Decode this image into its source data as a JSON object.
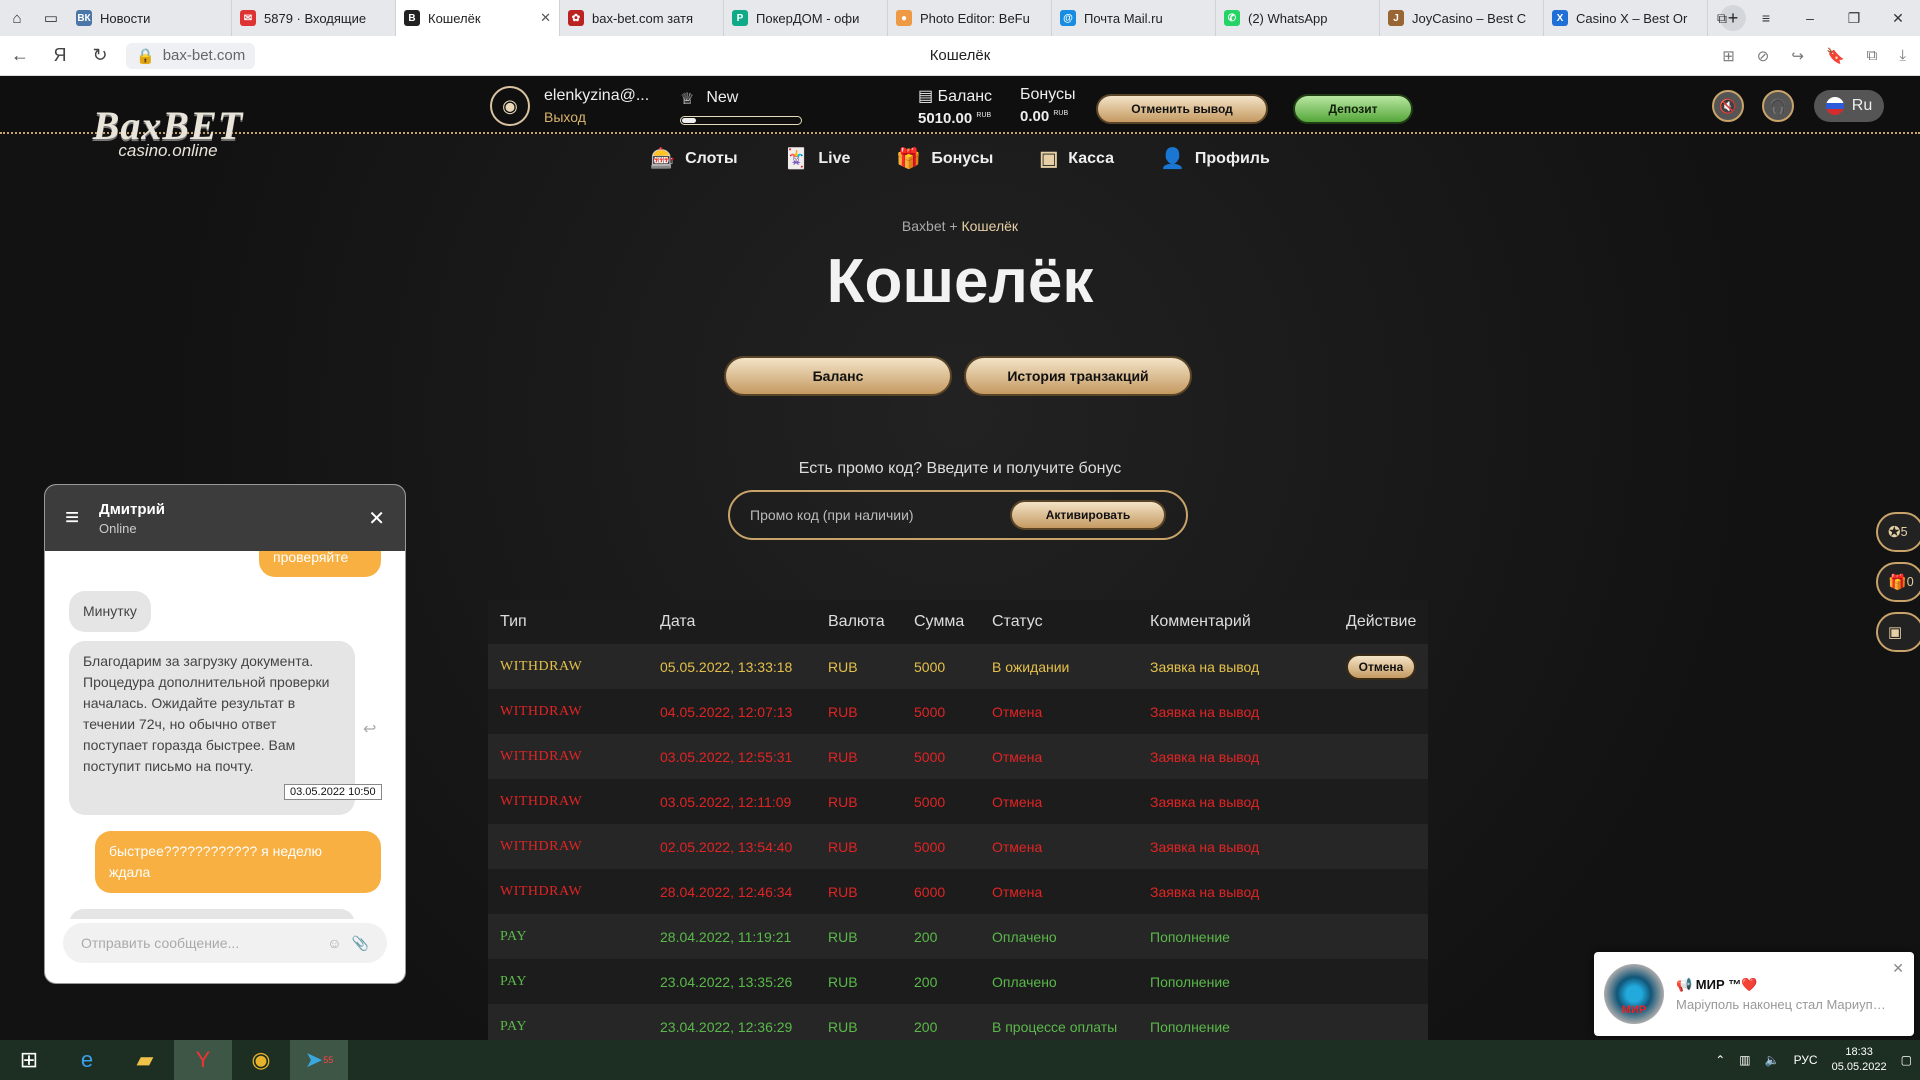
{
  "browser": {
    "tabs": [
      {
        "title": "Новости",
        "color": "#4a76a8",
        "glyph": "ВК",
        "active": false
      },
      {
        "title": "5879 · Входящие",
        "color": "#d33",
        "glyph": "✉",
        "active": false
      },
      {
        "title": "Кошелёк",
        "color": "#222",
        "glyph": "B",
        "active": true
      },
      {
        "title": "bax-bet.com затя",
        "color": "#b22",
        "glyph": "✿",
        "active": false
      },
      {
        "title": "ПокерДОМ - офи",
        "color": "#1a8",
        "glyph": "P",
        "active": false
      },
      {
        "title": "Photo Editor: BeFu",
        "color": "#e94",
        "glyph": "●",
        "active": false
      },
      {
        "title": "Почта Mail.ru",
        "color": "#168de2",
        "glyph": "@",
        "active": false
      },
      {
        "title": "(2) WhatsApp",
        "color": "#25d366",
        "glyph": "✆",
        "active": false
      },
      {
        "title": "JoyCasino – Best C",
        "color": "#963",
        "glyph": "J",
        "active": false
      },
      {
        "title": "Casino X – Best Or",
        "color": "#1f6fd6",
        "glyph": "X",
        "active": false
      }
    ],
    "url": "bax-bet.com",
    "page_title": "Кошелёк"
  },
  "site": {
    "logo": {
      "brand": "BaxBET",
      "sub": "casino.online"
    },
    "user": {
      "name": "elenkyzina@...",
      "logout": "Выход"
    },
    "level": {
      "name": "New",
      "progress": 0.12
    },
    "balance": {
      "label": "Баланс",
      "value": "5010.00",
      "currency": "RUB"
    },
    "bonuses": {
      "label": "Бонусы",
      "value": "0.00",
      "currency": "RUB"
    },
    "cancel_withdraw": "Отменить вывод",
    "deposit": "Депозит",
    "lang": "Ru",
    "menu": [
      {
        "label": "Слоты",
        "icon": "slots-icon",
        "glyph": "🎰"
      },
      {
        "label": "Live",
        "icon": "cards-icon",
        "glyph": "🃏"
      },
      {
        "label": "Бонусы",
        "icon": "gift-icon",
        "glyph": "🎁"
      },
      {
        "label": "Касса",
        "icon": "cashier-icon",
        "glyph": "▣"
      },
      {
        "label": "Профиль",
        "icon": "profile-icon",
        "glyph": "👤"
      }
    ],
    "breadcrumb": {
      "home": "Baxbet",
      "current": "Кошелёк"
    },
    "heading": "Кошелёк",
    "tabs": {
      "balance": "Баланс",
      "history": "История транзакций"
    },
    "promo": {
      "label": "Есть промо код? Введите и получите бонус",
      "placeholder": "Промо код (при наличии)",
      "button": "Активировать"
    },
    "table": {
      "headers": [
        "Тип",
        "Дата",
        "Валюта",
        "Сумма",
        "Статус",
        "Комментарий",
        "Действие"
      ],
      "rows": [
        {
          "type": "WITHDRAW",
          "date": "05.05.2022, 13:33:18",
          "currency": "RUB",
          "amount": "5000",
          "status": "В ожидании",
          "comment": "Заявка на вывод",
          "action": "Отмена",
          "kind": "pending"
        },
        {
          "type": "WITHDRAW",
          "date": "04.05.2022, 12:07:13",
          "currency": "RUB",
          "amount": "5000",
          "status": "Отмена",
          "comment": "Заявка на вывод",
          "action": "",
          "kind": "cancel"
        },
        {
          "type": "WITHDRAW",
          "date": "03.05.2022, 12:55:31",
          "currency": "RUB",
          "amount": "5000",
          "status": "Отмена",
          "comment": "Заявка на вывод",
          "action": "",
          "kind": "cancel"
        },
        {
          "type": "WITHDRAW",
          "date": "03.05.2022, 12:11:09",
          "currency": "RUB",
          "amount": "5000",
          "status": "Отмена",
          "comment": "Заявка на вывод",
          "action": "",
          "kind": "cancel"
        },
        {
          "type": "WITHDRAW",
          "date": "02.05.2022, 13:54:40",
          "currency": "RUB",
          "amount": "5000",
          "status": "Отмена",
          "comment": "Заявка на вывод",
          "action": "",
          "kind": "cancel"
        },
        {
          "type": "WITHDRAW",
          "date": "28.04.2022, 12:46:34",
          "currency": "RUB",
          "amount": "6000",
          "status": "Отмена",
          "comment": "Заявка на вывод",
          "action": "",
          "kind": "cancel"
        },
        {
          "type": "PAY",
          "date": "28.04.2022, 11:19:21",
          "currency": "RUB",
          "amount": "200",
          "status": "Оплачено",
          "comment": "Пополнение",
          "action": "",
          "kind": "paid"
        },
        {
          "type": "PAY",
          "date": "23.04.2022, 13:35:26",
          "currency": "RUB",
          "amount": "200",
          "status": "Оплачено",
          "comment": "Пополнение",
          "action": "",
          "kind": "paid"
        },
        {
          "type": "PAY",
          "date": "23.04.2022, 12:36:29",
          "currency": "RUB",
          "amount": "200",
          "status": "В процессе оплаты",
          "comment": "Пополнение",
          "action": "",
          "kind": "paid"
        }
      ]
    },
    "side_badges": [
      "5",
      "0"
    ]
  },
  "chat": {
    "agent": "Дмитрий",
    "status": "Online",
    "messages": [
      {
        "text": "проверяйте",
        "from": "user"
      },
      {
        "text": "Минутку",
        "from": "agent"
      },
      {
        "text": "Благодарим за загрузку документа. Процедура дополнительной проверки началась. Ожидайте результат в течении 72ч, но обычно ответ поступает горазда быстрее. Вам поступит письмо на почту.",
        "from": "agent"
      },
      {
        "text": "быстрее???????????? я неделю ждала",
        "from": "user"
      }
    ],
    "timestamp": "03.05.2022 10:50",
    "input_placeholder": "Отправить сообщение..."
  },
  "notification": {
    "title": "📢 МИР ™❤️",
    "text": "Маріуполь наконец стал Мариуполем — на въезде в осв..."
  },
  "taskbar": {
    "telegram_badge": "55",
    "lang": "РУС",
    "time": "18:33",
    "date": "05.05.2022"
  }
}
